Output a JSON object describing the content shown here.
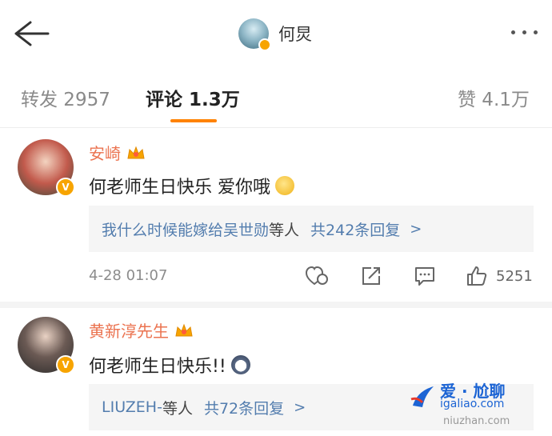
{
  "header": {
    "title": "何炅",
    "back_icon": "arrow-left-icon",
    "more_icon": "more-dots-icon"
  },
  "tabs": [
    {
      "label": "转发 2957",
      "active": false
    },
    {
      "label": "评论 1.3万",
      "active": true
    },
    {
      "label": "赞 4.1万",
      "active": false
    }
  ],
  "colors": {
    "accent": "#ff8200",
    "username": "#eb7350",
    "link": "#537dae",
    "vip_badge": "#f7a400"
  },
  "comments": [
    {
      "username": "安崎",
      "text": "何老师生日快乐 爱你哦",
      "emoji": "smile-emoji",
      "replies": {
        "names": "我什么时候能嫁给吴世勋",
        "suffix": "等人",
        "count": "共242条回复",
        "arrow": ">"
      },
      "time": "4-28 01:07",
      "likes": "5251"
    },
    {
      "username": "黄新淳先生",
      "text": "何老师生日快乐!!",
      "emoji": "husky-emoji",
      "replies": {
        "names": "LIUZEH-",
        "suffix": "等人",
        "count": "共72条回复",
        "arrow": ">"
      }
    }
  ],
  "watermark": {
    "title": "爱 · 尬聊",
    "url": "igaliao.com",
    "sub": "niuzhan.com"
  }
}
